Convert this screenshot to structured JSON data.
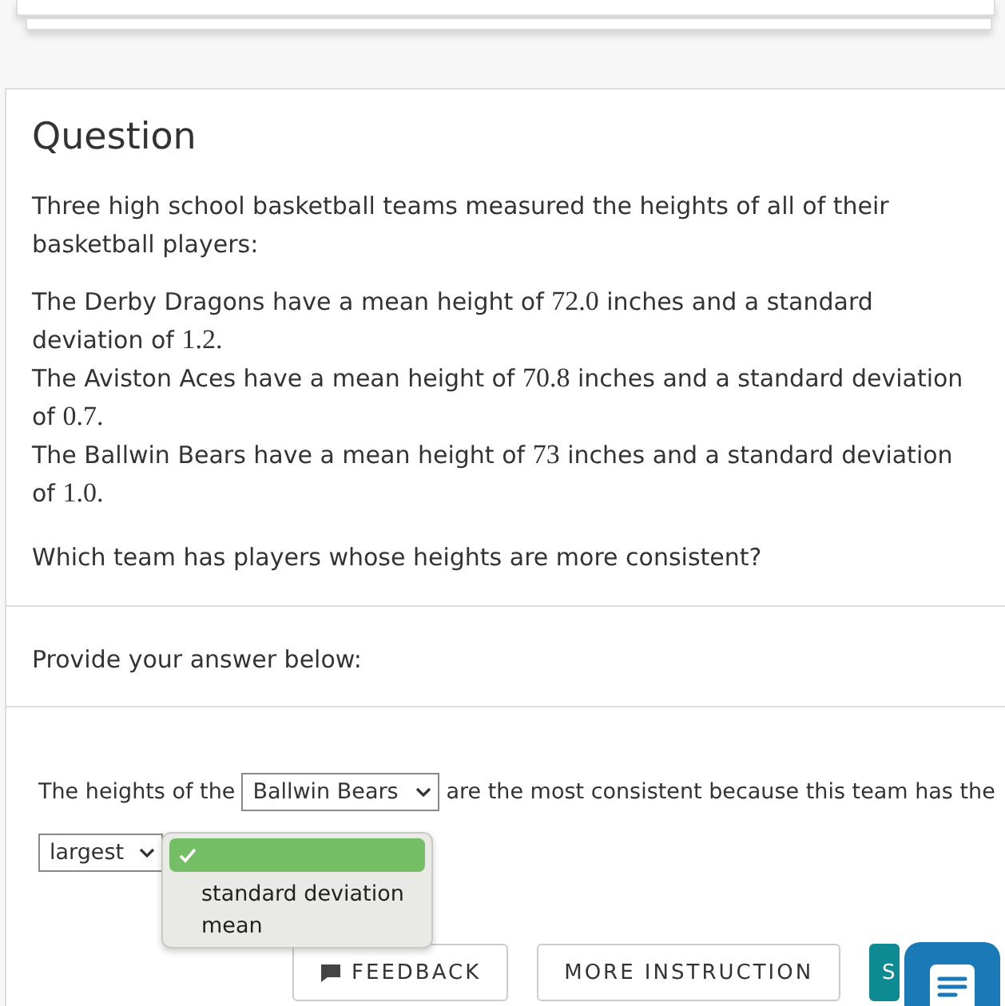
{
  "question": {
    "heading": "Question",
    "intro": "Three high school basketball teams measured the heights of all of their basketball players:",
    "facts": [
      [
        {
          "text": "The Derby Dragons have a mean height of ",
          "kind": "text"
        },
        {
          "text": "72.0",
          "kind": "number"
        },
        {
          "text": " inches and a standard deviation of ",
          "kind": "text"
        },
        {
          "text": "1.2.",
          "kind": "number"
        }
      ],
      [
        {
          "text": "The Aviston Aces have a mean height of ",
          "kind": "text"
        },
        {
          "text": "70.8",
          "kind": "number"
        },
        {
          "text": " inches and a standard deviation of ",
          "kind": "text"
        },
        {
          "text": "0.7.",
          "kind": "number"
        }
      ],
      [
        {
          "text": "The Ballwin Bears have a mean height of ",
          "kind": "text"
        },
        {
          "text": "73",
          "kind": "number"
        },
        {
          "text": " inches and a standard deviation of ",
          "kind": "text"
        },
        {
          "text": "1.0.",
          "kind": "number"
        }
      ]
    ],
    "prompt": "Which team has players whose heights are more consistent?"
  },
  "answer": {
    "label": "Provide your answer below:",
    "text_1": "The heights of the",
    "select_1": "Ballwin Bears",
    "text_2": "are the most consistent because this team has the",
    "select_2": "largest",
    "menu": [
      {
        "selected": true
      },
      {
        "label": "standard deviation",
        "selected": false
      },
      {
        "label": "mean",
        "selected": false
      }
    ]
  },
  "buttons": [
    {
      "label": "FEEDBACK",
      "kind": "feedback"
    },
    {
      "label": "MORE INSTRUCTION",
      "kind": "plain"
    },
    {
      "label": "S",
      "kind": "primary"
    }
  ]
}
